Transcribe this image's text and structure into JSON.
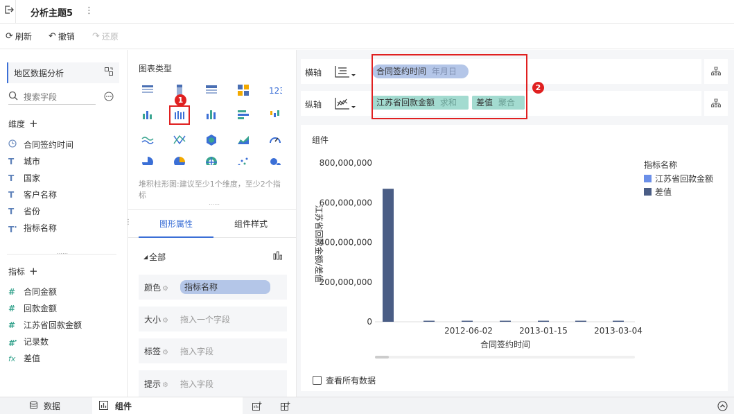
{
  "topbar": {
    "title": "分析主题5",
    "more": "⋮"
  },
  "toolbar": {
    "refresh": "刷新",
    "undo": "撤销",
    "redo": "还原"
  },
  "left": {
    "dataset": "地区数据分析",
    "search_placeholder": "搜索字段",
    "dimension_title": "维度",
    "dimensions": [
      {
        "icon": "clock",
        "label": "合同签约时间"
      },
      {
        "icon": "T",
        "label": "城市"
      },
      {
        "icon": "T",
        "label": "国家"
      },
      {
        "icon": "T",
        "label": "客户名称"
      },
      {
        "icon": "T",
        "label": "省份"
      },
      {
        "icon": "T*",
        "label": "指标名称"
      }
    ],
    "measure_title": "指标",
    "measures": [
      {
        "icon": "#",
        "label": "合同金额"
      },
      {
        "icon": "#",
        "label": "回款金额"
      },
      {
        "icon": "#",
        "label": "江苏省回款金额"
      },
      {
        "icon": "#*",
        "label": "记录数"
      },
      {
        "icon": "fx",
        "label": "差值"
      }
    ]
  },
  "mid": {
    "chart_type_title": "图表类型",
    "badge1": "1",
    "hint": "堆积柱形图:建议至少1个维度，至少2个指标",
    "tabs": [
      "图形属性",
      "组件样式"
    ],
    "all_label": "全部",
    "props": [
      {
        "label": "颜色",
        "value": "指标名称",
        "filled": true
      },
      {
        "label": "大小",
        "value": "拖入一个字段",
        "filled": false
      },
      {
        "label": "标签",
        "value": "拖入字段",
        "filled": false
      },
      {
        "label": "提示",
        "value": "拖入字段",
        "filled": false
      }
    ]
  },
  "axes": {
    "x_label": "横轴",
    "y_label": "纵轴",
    "x_field": "合同签约时间",
    "x_field_sub": "年月日",
    "y_field1": "江苏省回款金额",
    "y_field1_sub": "求和",
    "y_field2": "差值",
    "y_field2_sub": "聚合",
    "badge2": "2"
  },
  "component": {
    "title": "组件",
    "view_all": "查看所有数据"
  },
  "chart_data": {
    "type": "bar",
    "stacked": true,
    "xlabel": "合同签约时间",
    "ylabel": "江苏省回款金额/差值",
    "ylim": [
      0,
      800000000
    ],
    "yticks": [
      "800,000,000",
      "600,000,000",
      "400,000,000",
      "200,000,000",
      "0"
    ],
    "ytick_values": [
      800000000,
      600000000,
      400000000,
      200000000,
      0
    ],
    "xtick_labels": [
      "2012-06-02",
      "2013-01-15",
      "2013-03-04"
    ],
    "legend_title": "指标名称",
    "legend_position": "right",
    "series": [
      {
        "name": "江苏省回款金额",
        "color": "#6b8fe8",
        "values": [
          0,
          0,
          0,
          0,
          0,
          0,
          0
        ]
      },
      {
        "name": "差值",
        "color": "#4a5d85",
        "values": [
          670000000,
          3000000,
          3000000,
          3000000,
          3000000,
          3000000,
          5000000
        ]
      }
    ]
  },
  "bottombar": {
    "tab_data": "数据",
    "tab_component": "组件"
  }
}
